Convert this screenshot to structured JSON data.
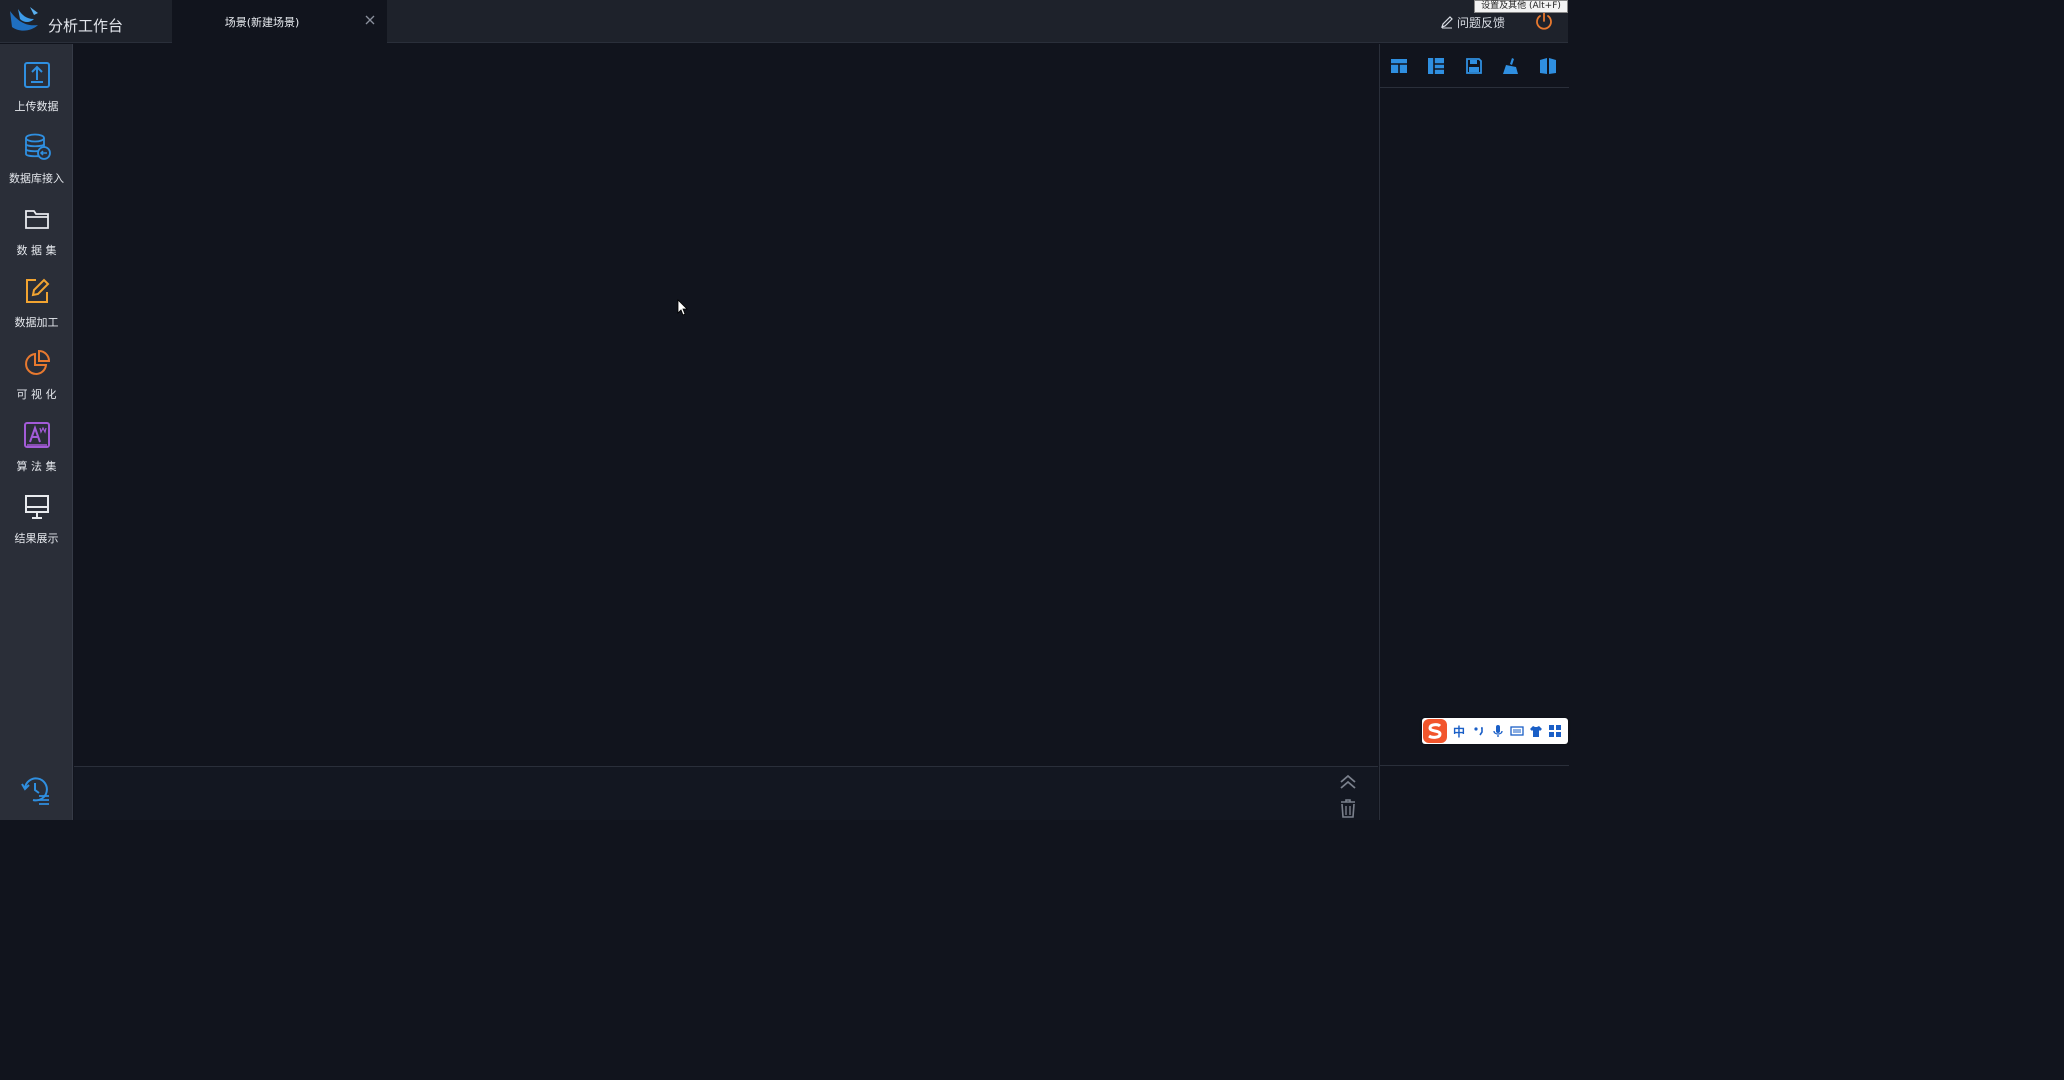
{
  "app": {
    "title": "分析工作台"
  },
  "tabs": [
    {
      "label": "场景(新建场景)"
    }
  ],
  "header": {
    "feedback_label": "问题反馈",
    "tooltip": "设置及其他 (Alt+F)"
  },
  "sidebar": {
    "items": [
      {
        "label": "上传数据",
        "icon": "upload-icon",
        "color": "#2f8fe0"
      },
      {
        "label": "数据库接入",
        "icon": "database-connect-icon",
        "color": "#2f8fe0"
      },
      {
        "label": "数 据 集",
        "icon": "folder-icon",
        "color": "#e8eaee"
      },
      {
        "label": "数据加工",
        "icon": "edit-icon",
        "color": "#f2a431"
      },
      {
        "label": "可 视 化",
        "icon": "pie-chart-icon",
        "color": "#e8792f"
      },
      {
        "label": "算 法 集",
        "icon": "algorithm-icon",
        "color": "#a35bd8"
      },
      {
        "label": "结果展示",
        "icon": "monitor-icon",
        "color": "#e8eaee"
      }
    ]
  },
  "right_toolbar": {
    "tools": [
      {
        "icon": "layout-top-icon"
      },
      {
        "icon": "layout-left-icon"
      },
      {
        "icon": "save-icon"
      },
      {
        "icon": "clear-brush-icon"
      },
      {
        "icon": "book-icon"
      }
    ]
  },
  "ime": {
    "mode_label": "中"
  },
  "colors": {
    "accent": "#2f8fe0",
    "power": "#e8792f",
    "background": "#11141d",
    "sidebar": "#2a2e38"
  }
}
